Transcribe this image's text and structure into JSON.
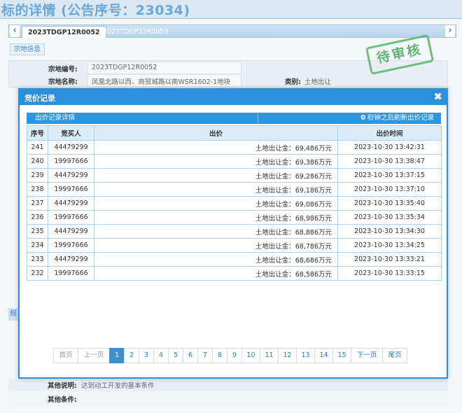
{
  "page": {
    "title": "标的详情 (公告序号：23034)",
    "tabs": [
      "2023TDGP12R0052",
      "2023TDGP12R0053"
    ],
    "section_button": "宗地信息",
    "stamp": "待审核",
    "info": {
      "parcel_no_label": "宗地编号:",
      "parcel_no": "2023TDGP12R0052",
      "parcel_name_label": "宗地名称:",
      "parcel_name": "凤凰北路以西、商贸城路以南WSR1602-1地块",
      "category_label": "类别:",
      "category": "土地出让"
    },
    "other_desc_label": "其他说明:",
    "other_desc": "达到动工开发的基本条件",
    "other_cond_label": "其他条件:",
    "left_strip_char": "规"
  },
  "modal": {
    "title": "竞价记录",
    "close_glyph": "✖",
    "sub_left": "出价记录详情",
    "countdown": "0",
    "sub_right": " 秒钟之后刷新出价记录",
    "columns": [
      "序号",
      "竞买人",
      "出价",
      "出价时间"
    ],
    "rows": [
      {
        "no": "241",
        "bidder": "44479299",
        "price": "土地出让金：69,486万元",
        "time": "2023-10-30 13:42:31"
      },
      {
        "no": "240",
        "bidder": "19997666",
        "price": "土地出让金：69,386万元",
        "time": "2023-10-30 13:38:47"
      },
      {
        "no": "239",
        "bidder": "44479299",
        "price": "土地出让金：69,286万元",
        "time": "2023-10-30 13:37:15"
      },
      {
        "no": "238",
        "bidder": "19997666",
        "price": "土地出让金：69,186万元",
        "time": "2023-10-30 13:37:10"
      },
      {
        "no": "237",
        "bidder": "44479299",
        "price": "土地出让金：69,086万元",
        "time": "2023-10-30 13:35:40"
      },
      {
        "no": "236",
        "bidder": "19997666",
        "price": "土地出让金：68,986万元",
        "time": "2023-10-30 13:35:34"
      },
      {
        "no": "235",
        "bidder": "44479299",
        "price": "土地出让金：68,886万元",
        "time": "2023-10-30 13:34:30"
      },
      {
        "no": "234",
        "bidder": "19997666",
        "price": "土地出让金：68,786万元",
        "time": "2023-10-30 13:34:25"
      },
      {
        "no": "233",
        "bidder": "44479299",
        "price": "土地出让金：68,686万元",
        "time": "2023-10-30 13:33:21"
      },
      {
        "no": "232",
        "bidder": "19997666",
        "price": "土地出让金：68,586万元",
        "time": "2023-10-30 13:33:15"
      }
    ],
    "pager": {
      "first": "首页",
      "prev": "上一页",
      "pages": [
        "1",
        "2",
        "3",
        "4",
        "5",
        "6",
        "7",
        "8",
        "9",
        "10",
        "11",
        "12",
        "13",
        "14",
        "15"
      ],
      "current": "1",
      "next": "下一页",
      "last": "尾页"
    }
  }
}
